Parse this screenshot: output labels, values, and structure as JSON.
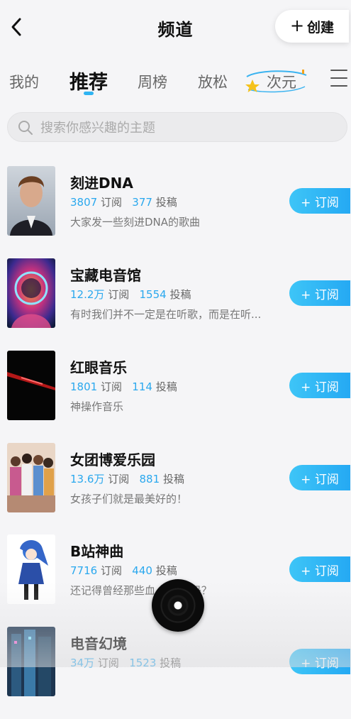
{
  "header": {
    "title": "频道",
    "create_label": "创建"
  },
  "tabs": [
    "我的",
    "推荐",
    "周榜",
    "放松",
    "次元"
  ],
  "search": {
    "placeholder": "搜索你感兴趣的主题"
  },
  "subscribe_label": "+ 订阅",
  "stat_labels": {
    "subscribe": "订阅",
    "posts": "投稿"
  },
  "channels": [
    {
      "name": "刻进DNA",
      "subs": "3807",
      "posts": "377",
      "desc": "大家发一些刻进DNA的歌曲"
    },
    {
      "name": "宝藏电音馆",
      "subs": "12.2万",
      "posts": "1554",
      "desc": "有时我们并不一定是在听歌，而是在听..."
    },
    {
      "name": "红眼音乐",
      "subs": "1801",
      "posts": "114",
      "desc": "神操作音乐"
    },
    {
      "name": "女团博爱乐园",
      "subs": "13.6万",
      "posts": "881",
      "desc": "女孩子们就是最美好的！"
    },
    {
      "name": "B站神曲",
      "subs": "7716",
      "posts": "440",
      "desc": "还记得曾经那些血 的神曲吗？"
    },
    {
      "name": "电音幻境",
      "subs": "34万",
      "posts": "1523",
      "desc": ""
    }
  ],
  "colors": {
    "accent": "#2aa8ee",
    "button_start": "#3ec5f7",
    "button_end": "#25a9f3"
  }
}
